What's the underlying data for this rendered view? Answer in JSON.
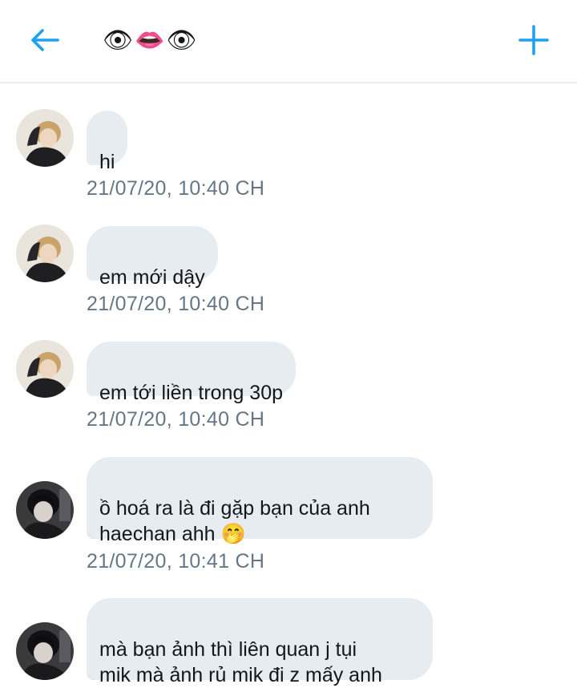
{
  "header": {
    "back_icon": "arrow-left-icon",
    "title": "👁👄👁",
    "add_icon": "plus-icon",
    "accent_color": "#1da1f2"
  },
  "messages": [
    {
      "sender": "other-a",
      "text": "hi",
      "time": "21/07/20, 10:40 CH"
    },
    {
      "sender": "other-a",
      "text": "em mới dậy",
      "time": "21/07/20, 10:40 CH"
    },
    {
      "sender": "other-a",
      "text": "em tới liền trong 30p",
      "time": "21/07/20, 10:40 CH"
    },
    {
      "sender": "other-b",
      "text": "ồ hoá ra là đi gặp bạn của anh\nhaechan ahh 🤭",
      "time": "21/07/20, 10:41 CH"
    },
    {
      "sender": "other-b",
      "text": "mà bạn ảnh thì liên quan j tụi\nmik mà ảnh rủ mik đi z mấy anh",
      "time": ""
    }
  ],
  "colors": {
    "bubble_bg": "#e6ecf0",
    "timestamp": "#657786",
    "divider": "#e6ecf0"
  }
}
